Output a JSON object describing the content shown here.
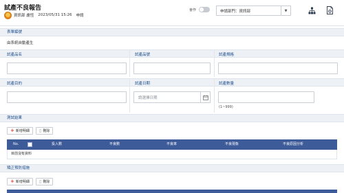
{
  "header": {
    "title": "試產不良報告",
    "user_dept": "資訊部 盧恆",
    "date": "2023/05/31 15:26",
    "status": "申請",
    "toggle_label": "會作",
    "dept_select_value": "申請部門：資訊部"
  },
  "sections": {
    "form_number": {
      "label": "表單編號",
      "value": "由系統自動產生"
    },
    "fields_row1": {
      "product_name_label": "試產品名",
      "product_no_label": "試產品號",
      "spec_label": "試產規格"
    },
    "fields_row2": {
      "purpose_label": "試產目的",
      "date_label": "試產日期",
      "date_placeholder": "請選擇日期",
      "qty_label": "試產數量",
      "qty_hint": "(1~999)"
    },
    "test_results": {
      "title": "測試結果",
      "add_label": "新增明細",
      "delete_label": "刪除",
      "columns": [
        "No.",
        "",
        "投入數",
        "不良數",
        "不良率",
        "不良現象",
        "不良原因分析"
      ],
      "empty_text": "目前沒有資料"
    },
    "corrective": {
      "title": "矯正預防措施",
      "add_label": "新增明細",
      "delete_label": "刪除"
    }
  },
  "icons": {
    "org_chart": "org-chart-icon",
    "document": "document-icon",
    "calendar": "calendar-icon"
  },
  "colors": {
    "table_header": "#3d5a99",
    "section_bar": "#edf1f6",
    "label_blue": "#1f4e8c",
    "add_plus": "#e03a2f"
  }
}
